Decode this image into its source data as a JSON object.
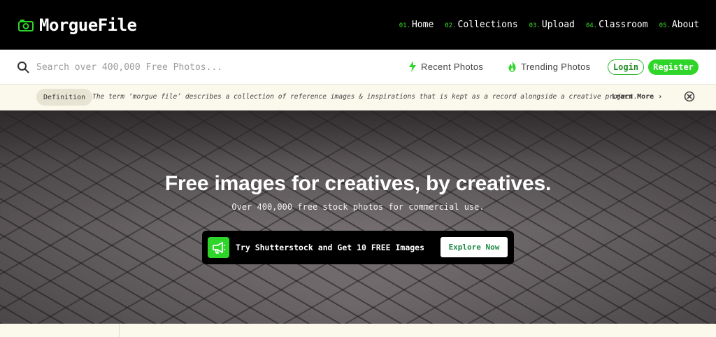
{
  "brand": {
    "name": "MorgueFile",
    "accent": "#2fd62a"
  },
  "nav": {
    "items": [
      {
        "num": "01.",
        "label": "Home"
      },
      {
        "num": "02.",
        "label": "Collections"
      },
      {
        "num": "03.",
        "label": "Upload"
      },
      {
        "num": "04.",
        "label": "Classroom"
      },
      {
        "num": "05.",
        "label": "About"
      }
    ]
  },
  "search": {
    "placeholder": "Search over 400,000 Free Photos...",
    "value": ""
  },
  "links": {
    "recent": "Recent Photos",
    "trending": "Trending Photos"
  },
  "auth": {
    "login": "Login",
    "register": "Register"
  },
  "definition": {
    "badge": "Definition",
    "text": "The term ‘morgue file’ describes a collection of reference images & inspirations that is kept as a record alongside a creative project.",
    "learn_more": "Learn More ›"
  },
  "hero": {
    "title": "Free images for creatives, by creatives.",
    "subtitle": "Over 400,000 free stock photos for commercial use.",
    "promo_text": "Try Shutterstock and Get 10 FREE Images",
    "promo_button": "Explore Now"
  },
  "icons": {
    "logo": "camera-icon",
    "search": "search-icon",
    "recent": "lightning-icon",
    "trending": "flame-icon",
    "close": "close-circle-icon",
    "promo": "megaphone-icon"
  }
}
